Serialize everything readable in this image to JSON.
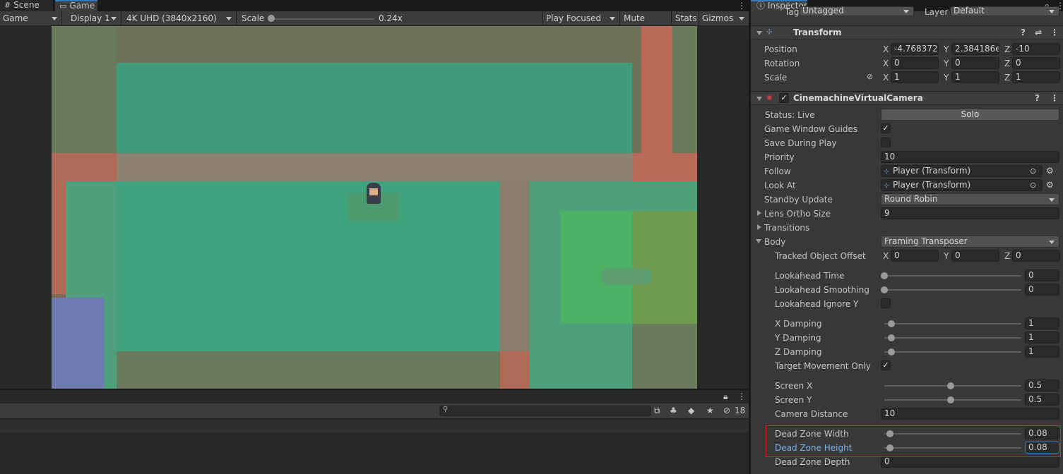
{
  "tabs": {
    "scene": "Scene",
    "game": "Game"
  },
  "toolbar": {
    "game_mode": "Game",
    "display": "Display 1",
    "resolution": "4K UHD (3840x2160)",
    "scale_label": "Scale",
    "scale_value": "0.24x",
    "play_focused": "Play Focused",
    "mute_audio": "Mute Audio",
    "stats": "Stats",
    "gizmos": "Gizmos"
  },
  "console": {
    "hidden_count": "18"
  },
  "inspector": {
    "tab": "Inspector",
    "tag_label": "Tag",
    "tag_value": "Untagged",
    "layer_label": "Layer",
    "layer_value": "Default",
    "transform": {
      "title": "Transform",
      "position_label": "Position",
      "position": {
        "x": "-4.768372",
        "y": "2.384186e",
        "z": "-10"
      },
      "rotation_label": "Rotation",
      "rotation": {
        "x": "0",
        "y": "0",
        "z": "0"
      },
      "scale_label": "Scale",
      "scale": {
        "x": "1",
        "y": "1",
        "z": "1"
      }
    },
    "vcam": {
      "title": "CinemachineVirtualCamera",
      "status_label": "Status: Live",
      "solo_label": "Solo",
      "game_window_guides": "Game Window Guides",
      "save_during_play": "Save During Play",
      "priority_label": "Priority",
      "priority_value": "10",
      "follow_label": "Follow",
      "follow_value": "Player (Transform)",
      "look_at_label": "Look At",
      "look_at_value": "Player (Transform)",
      "standby_label": "Standby Update",
      "standby_value": "Round Robin",
      "lens_label": "Lens Ortho Size",
      "lens_value": "9",
      "transitions_label": "Transitions",
      "body_label": "Body",
      "body_value": "Framing Transposer",
      "tracked_offset_label": "Tracked Object Offset",
      "tracked_offset": {
        "x": "0",
        "y": "0",
        "z": "0"
      },
      "lookahead_time_label": "Lookahead Time",
      "lookahead_time": "0",
      "lookahead_smoothing_label": "Lookahead Smoothing",
      "lookahead_smoothing": "0",
      "lookahead_ignore_y_label": "Lookahead Ignore Y",
      "x_damping_label": "X Damping",
      "x_damping": "1",
      "y_damping_label": "Y Damping",
      "y_damping": "1",
      "z_damping_label": "Z Damping",
      "z_damping": "1",
      "target_movement_only_label": "Target Movement Only",
      "screen_x_label": "Screen X",
      "screen_x": "0.5",
      "screen_y_label": "Screen Y",
      "screen_y": "0.5",
      "camera_distance_label": "Camera Distance",
      "camera_distance": "10",
      "dead_zone_width_label": "Dead Zone Width",
      "dead_zone_width": "0.08",
      "dead_zone_height_label": "Dead Zone Height",
      "dead_zone_height": "0.08",
      "dead_zone_depth_label": "Dead Zone Depth",
      "dead_zone_depth": "0"
    }
  },
  "axis_labels": {
    "x": "X",
    "y": "Y",
    "z": "Z"
  },
  "colors": {
    "accent": "#3a79bb",
    "highlight": "#e02020",
    "active_label": "#7fb3ea"
  }
}
